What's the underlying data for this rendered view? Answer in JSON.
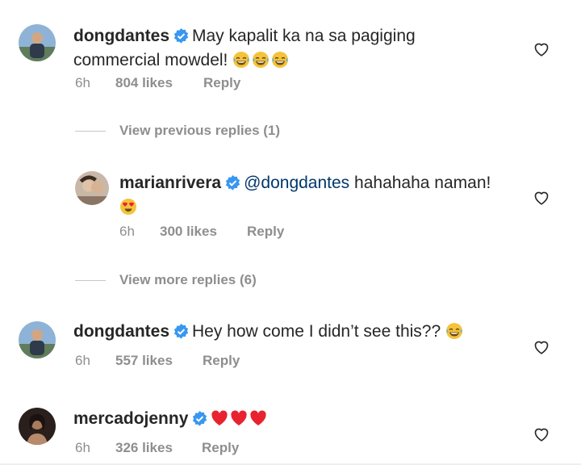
{
  "comments": [
    {
      "username": "dongdantes",
      "text": "May kapalit ka na sa pagiging commercial mowdel!",
      "line1": "May kapalit ka na sa pagiging",
      "line2": "commercial mowdel!",
      "emojis": [
        "laughing-tears",
        "laughing-tears",
        "laughing-tears"
      ],
      "time": "6h",
      "likes": "804 likes",
      "reply_label": "Reply"
    },
    {
      "username": "marianrivera",
      "mention": "@dongdantes",
      "text": "hahahaha naman!",
      "emojis": [
        "heart-eyes"
      ],
      "time": "6h",
      "likes": "300 likes",
      "reply_label": "Reply"
    },
    {
      "username": "dongdantes",
      "text": "Hey how come I didn’t see this??",
      "emojis": [
        "laughing-tears"
      ],
      "time": "6h",
      "likes": "557 likes",
      "reply_label": "Reply"
    },
    {
      "username": "mercadojenny",
      "text": "",
      "emojis": [
        "red-heart",
        "red-heart",
        "red-heart"
      ],
      "time": "6h",
      "likes": "326 likes",
      "reply_label": "Reply"
    }
  ],
  "threads": {
    "previous_replies": "View previous replies (1)",
    "more_replies": "View more replies (6)"
  },
  "colors": {
    "text": "#262626",
    "secondary": "#8e8e8e",
    "mention": "#00376b",
    "verified": "#3897f0"
  },
  "icons": {
    "verified": "verified-badge-icon",
    "like": "heart-outline-icon"
  }
}
